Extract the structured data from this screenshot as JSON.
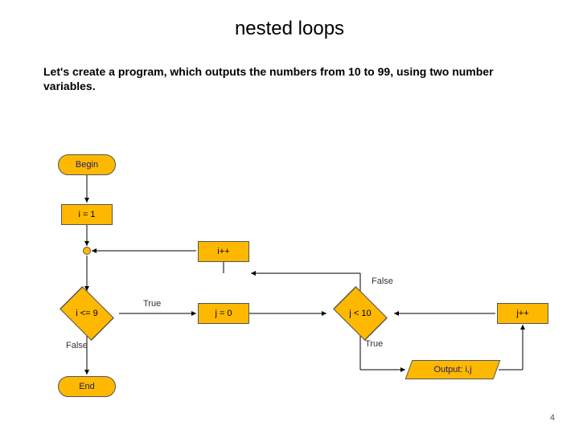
{
  "title": "nested loops",
  "intro": "Let's create a program, which outputs the numbers from 10 to 99, using two number variables.",
  "flow": {
    "begin": "Begin",
    "init_i": "i = 1",
    "inc_i": "i++",
    "cond_i": "i <= 9",
    "init_j": "j = 0",
    "cond_j": "j < 10",
    "inc_j": "j++",
    "output": "Output: i,j",
    "end": "End",
    "labels": {
      "true": "True",
      "false": "False"
    }
  },
  "page_number": "4"
}
